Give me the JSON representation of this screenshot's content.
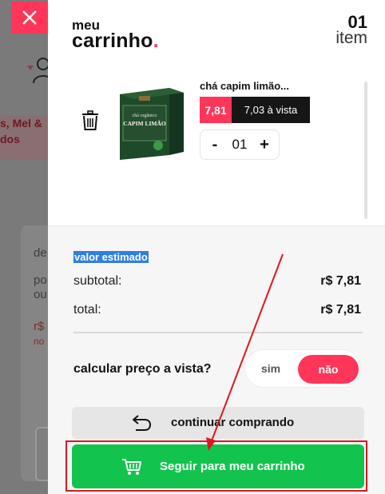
{
  "background": {
    "promo_line1": "s, Mel &",
    "promo_line2": "dos",
    "text_de": "de",
    "text_po": "po",
    "text_ou": "ou",
    "text_price": "r$",
    "text_no": "no"
  },
  "cart": {
    "title_small": "meu",
    "title_big": "carrinho",
    "title_dot": ".",
    "count": "01",
    "count_label": "item"
  },
  "item": {
    "name": "chá capim limão...",
    "price": "7,81",
    "cash_price": "7,03 à vista",
    "quantity": "01",
    "qty_minus": "-",
    "qty_plus": "+",
    "image_lines": [
      "chá orgânico",
      "CAPIM LIMÃO"
    ]
  },
  "summary": {
    "estimated_label": "valor estimado",
    "subtotal_label": "subtotal:",
    "subtotal_value": "r$ 7,81",
    "total_label": "total:",
    "total_value": "r$ 7,81",
    "calc_label": "calcular preço a vista?",
    "toggle_yes": "sim",
    "toggle_no": "não",
    "continue_label": "continuar comprando",
    "checkout_label": "Seguir para meu carrinho"
  },
  "colors": {
    "accent": "#ff3659",
    "checkout_green": "#12c44e",
    "annotation_red": "#e0161f",
    "cash_bg": "#161616"
  },
  "icons": [
    "close-icon",
    "user-icon",
    "trash-icon",
    "undo-arrow-icon",
    "cart-icon"
  ]
}
